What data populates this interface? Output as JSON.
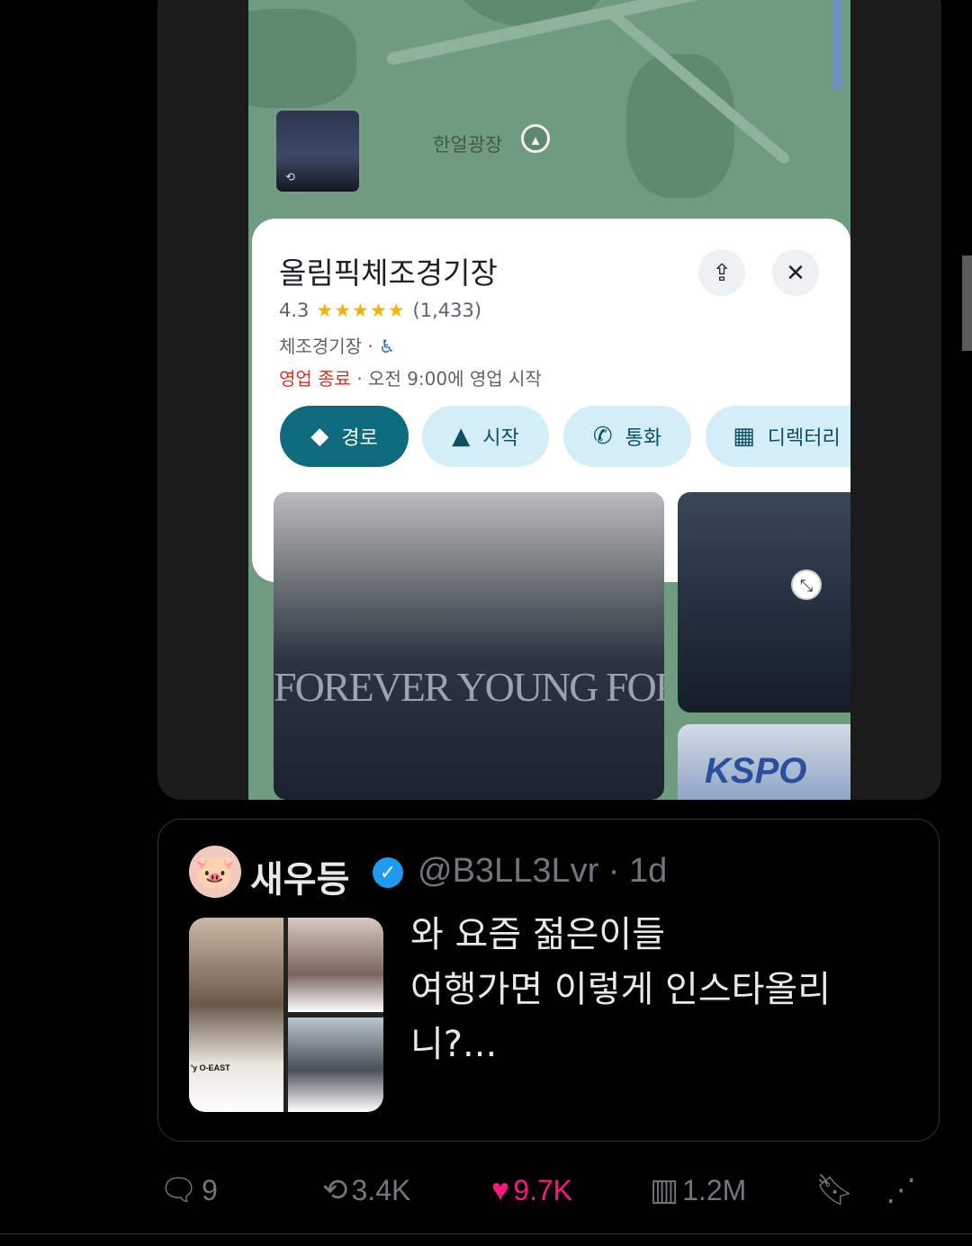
{
  "media": {
    "map_poi_label": "한얼광장",
    "place": {
      "name": "올림픽체조경기장",
      "rating": "4.3",
      "stars": "★★★★★",
      "review_count": "(1,433)",
      "category": "체조경기장 · ",
      "status_closed": "영업 종료",
      "hours_text": " · 오전 9:00에 영업 시작"
    },
    "chips": {
      "directions": "경로",
      "start": "시작",
      "call": "통화",
      "directory": "디렉터리"
    },
    "photo_1_text": "FOREVER YOUNG  FOREVER",
    "photo_3_text": "KSPO"
  },
  "quote": {
    "display_name": "새우등",
    "handle": "@B3LL3Lvr",
    "separator": " · ",
    "time": "1d",
    "text": "와 요즘 젊은이들\n여행가면 이렇게 인스타올리\n니?...",
    "media_caption": "'y O-EAST"
  },
  "actions": {
    "replies": "9",
    "retweets": "3.4K",
    "likes": "9.7K",
    "views": "1.2M"
  },
  "colors": {
    "like_active": "#f91880",
    "verified": "#1d9bf0",
    "directions_chip": "#0e6b7d",
    "closed_status": "#d93025"
  },
  "icons": [
    "share-icon",
    "close-icon",
    "wheelchair-icon",
    "directions-icon",
    "navigation-icon",
    "phone-icon",
    "store-icon",
    "expand-icon",
    "verified-icon",
    "reply-icon",
    "retweet-icon",
    "heart-icon",
    "views-icon",
    "bookmark-icon",
    "share-network-icon"
  ]
}
